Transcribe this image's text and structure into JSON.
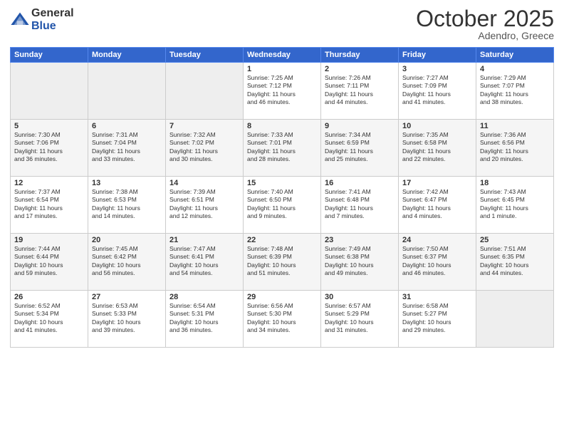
{
  "header": {
    "logo_general": "General",
    "logo_blue": "Blue",
    "month": "October 2025",
    "location": "Adendro, Greece"
  },
  "days_of_week": [
    "Sunday",
    "Monday",
    "Tuesday",
    "Wednesday",
    "Thursday",
    "Friday",
    "Saturday"
  ],
  "weeks": [
    [
      {
        "day": "",
        "info": ""
      },
      {
        "day": "",
        "info": ""
      },
      {
        "day": "",
        "info": ""
      },
      {
        "day": "1",
        "info": "Sunrise: 7:25 AM\nSunset: 7:12 PM\nDaylight: 11 hours\nand 46 minutes."
      },
      {
        "day": "2",
        "info": "Sunrise: 7:26 AM\nSunset: 7:11 PM\nDaylight: 11 hours\nand 44 minutes."
      },
      {
        "day": "3",
        "info": "Sunrise: 7:27 AM\nSunset: 7:09 PM\nDaylight: 11 hours\nand 41 minutes."
      },
      {
        "day": "4",
        "info": "Sunrise: 7:29 AM\nSunset: 7:07 PM\nDaylight: 11 hours\nand 38 minutes."
      }
    ],
    [
      {
        "day": "5",
        "info": "Sunrise: 7:30 AM\nSunset: 7:06 PM\nDaylight: 11 hours\nand 36 minutes."
      },
      {
        "day": "6",
        "info": "Sunrise: 7:31 AM\nSunset: 7:04 PM\nDaylight: 11 hours\nand 33 minutes."
      },
      {
        "day": "7",
        "info": "Sunrise: 7:32 AM\nSunset: 7:02 PM\nDaylight: 11 hours\nand 30 minutes."
      },
      {
        "day": "8",
        "info": "Sunrise: 7:33 AM\nSunset: 7:01 PM\nDaylight: 11 hours\nand 28 minutes."
      },
      {
        "day": "9",
        "info": "Sunrise: 7:34 AM\nSunset: 6:59 PM\nDaylight: 11 hours\nand 25 minutes."
      },
      {
        "day": "10",
        "info": "Sunrise: 7:35 AM\nSunset: 6:58 PM\nDaylight: 11 hours\nand 22 minutes."
      },
      {
        "day": "11",
        "info": "Sunrise: 7:36 AM\nSunset: 6:56 PM\nDaylight: 11 hours\nand 20 minutes."
      }
    ],
    [
      {
        "day": "12",
        "info": "Sunrise: 7:37 AM\nSunset: 6:54 PM\nDaylight: 11 hours\nand 17 minutes."
      },
      {
        "day": "13",
        "info": "Sunrise: 7:38 AM\nSunset: 6:53 PM\nDaylight: 11 hours\nand 14 minutes."
      },
      {
        "day": "14",
        "info": "Sunrise: 7:39 AM\nSunset: 6:51 PM\nDaylight: 11 hours\nand 12 minutes."
      },
      {
        "day": "15",
        "info": "Sunrise: 7:40 AM\nSunset: 6:50 PM\nDaylight: 11 hours\nand 9 minutes."
      },
      {
        "day": "16",
        "info": "Sunrise: 7:41 AM\nSunset: 6:48 PM\nDaylight: 11 hours\nand 7 minutes."
      },
      {
        "day": "17",
        "info": "Sunrise: 7:42 AM\nSunset: 6:47 PM\nDaylight: 11 hours\nand 4 minutes."
      },
      {
        "day": "18",
        "info": "Sunrise: 7:43 AM\nSunset: 6:45 PM\nDaylight: 11 hours\nand 1 minute."
      }
    ],
    [
      {
        "day": "19",
        "info": "Sunrise: 7:44 AM\nSunset: 6:44 PM\nDaylight: 10 hours\nand 59 minutes."
      },
      {
        "day": "20",
        "info": "Sunrise: 7:45 AM\nSunset: 6:42 PM\nDaylight: 10 hours\nand 56 minutes."
      },
      {
        "day": "21",
        "info": "Sunrise: 7:47 AM\nSunset: 6:41 PM\nDaylight: 10 hours\nand 54 minutes."
      },
      {
        "day": "22",
        "info": "Sunrise: 7:48 AM\nSunset: 6:39 PM\nDaylight: 10 hours\nand 51 minutes."
      },
      {
        "day": "23",
        "info": "Sunrise: 7:49 AM\nSunset: 6:38 PM\nDaylight: 10 hours\nand 49 minutes."
      },
      {
        "day": "24",
        "info": "Sunrise: 7:50 AM\nSunset: 6:37 PM\nDaylight: 10 hours\nand 46 minutes."
      },
      {
        "day": "25",
        "info": "Sunrise: 7:51 AM\nSunset: 6:35 PM\nDaylight: 10 hours\nand 44 minutes."
      }
    ],
    [
      {
        "day": "26",
        "info": "Sunrise: 6:52 AM\nSunset: 5:34 PM\nDaylight: 10 hours\nand 41 minutes."
      },
      {
        "day": "27",
        "info": "Sunrise: 6:53 AM\nSunset: 5:33 PM\nDaylight: 10 hours\nand 39 minutes."
      },
      {
        "day": "28",
        "info": "Sunrise: 6:54 AM\nSunset: 5:31 PM\nDaylight: 10 hours\nand 36 minutes."
      },
      {
        "day": "29",
        "info": "Sunrise: 6:56 AM\nSunset: 5:30 PM\nDaylight: 10 hours\nand 34 minutes."
      },
      {
        "day": "30",
        "info": "Sunrise: 6:57 AM\nSunset: 5:29 PM\nDaylight: 10 hours\nand 31 minutes."
      },
      {
        "day": "31",
        "info": "Sunrise: 6:58 AM\nSunset: 5:27 PM\nDaylight: 10 hours\nand 29 minutes."
      },
      {
        "day": "",
        "info": ""
      }
    ]
  ]
}
